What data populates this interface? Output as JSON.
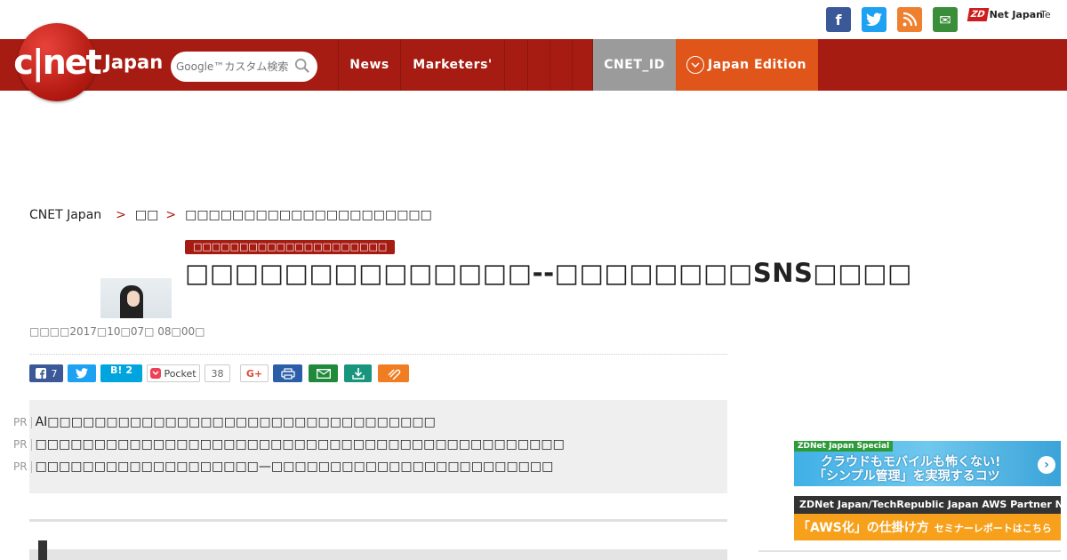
{
  "social": {
    "facebook_glyph": "f",
    "mail_glyph": "✉",
    "zdnet_mark": "ZD",
    "zdnet_text": "Net Japan",
    "techrepublic_text": "Te"
  },
  "header": {
    "logo_text": "c|net",
    "logo_suffix": "Japan",
    "search_placeholder": "Google™カスタム検索",
    "nav": {
      "news": "News",
      "marketers": "Marketers'",
      "cnet_id": "CNET_ID",
      "edition": "Japan Edition"
    }
  },
  "breadcrumb": {
    "home": "CNET Japan",
    "sep": ">",
    "section": "□□",
    "current": "□□□□□□□□□□□□□□□□□□□□□"
  },
  "article": {
    "category": "□□□□□□□□□□□□□□□□□□□□□",
    "title": "□□□□□□□□□□□□□□--□□□□□□□□SNS□□□□",
    "dateline": "□□□□2017□10□07□ 08□00□"
  },
  "share": {
    "facebook_count": "7",
    "hatena_label": "B!",
    "hatena_count": "2",
    "pocket_label": "Pocket",
    "pocket_count": "38",
    "gplus_label": "G+"
  },
  "pr": [
    {
      "label": "PR",
      "text": "AI□□□□□□□□□□□□□□□□□□□□□□□□□□□□□□□□□"
    },
    {
      "label": "PR",
      "text": "□□□□□□□□□□□□□□□□□□□□□□□□□□□□□□□□□□□□□□□□□□□□□"
    },
    {
      "label": "PR",
      "text": "□□□□□□□□□□□□□□□□□□□—□□□□□□□□□□□□□□□□□□□□□□□□"
    }
  ],
  "sidebar": {
    "banner1": {
      "tag": "ZDNet Japan Special",
      "line1": "クラウドもモバイルも怖くない!",
      "line2": "「シンプル管理」を実現するコツ",
      "arrow": "›"
    },
    "banner2": {
      "top": "ZDNet Japan/TechRepublic Japan  AWS Partner Network",
      "main": "「AWS化」の仕掛け方",
      "sub": "セミナーレポートはこちら"
    }
  }
}
